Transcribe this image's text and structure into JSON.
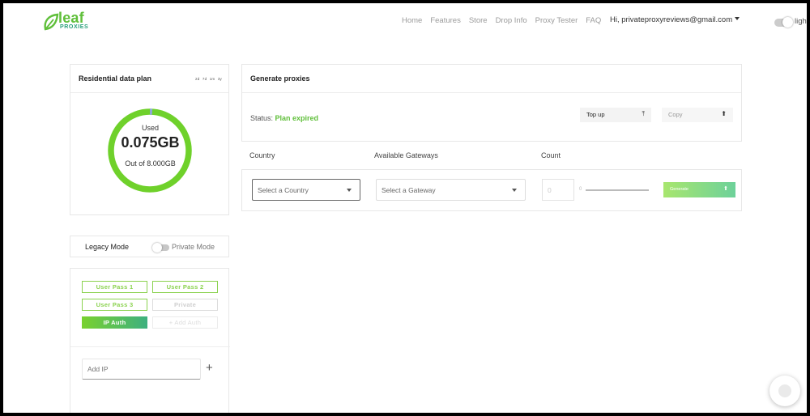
{
  "brand": {
    "name": "leaf",
    "sub": "PROXIES"
  },
  "nav": {
    "items": [
      "Home",
      "Features",
      "Store",
      "Drop Info",
      "Proxy Tester",
      "FAQ"
    ],
    "user": "Hi, privateproxyreviews@gmail.com",
    "theme_label": "light"
  },
  "plan": {
    "title": "Residential data plan",
    "range_tabs": [
      "2d",
      "7d",
      "1m",
      "3y"
    ],
    "used_label": "Used",
    "used_value": "0.075GB",
    "total_label": "Out of 8.000GB",
    "used_fraction": 0.009,
    "ring_color": "#6fd12b",
    "used_color": "#8ea7d8"
  },
  "mode": {
    "legacy": "Legacy Mode",
    "private": "Private Mode"
  },
  "auth": {
    "buttons": [
      "User Pass 1",
      "User Pass 2",
      "User Pass 3",
      "Private",
      "IP Auth",
      "+ Add Auth"
    ],
    "ip_placeholder": "Add IP",
    "add_icon": "+"
  },
  "generate": {
    "title": "Generate proxies",
    "status_label": "Status:",
    "status_value": "Plan expired",
    "topup_label": "Top up",
    "copy_label": "Copy"
  },
  "form": {
    "country_label": "Country",
    "gateway_label": "Available Gateways",
    "count_label": "Count",
    "country_placeholder": "Select a Country",
    "gateway_placeholder": "Select a Gateway",
    "count_value": "0",
    "slider_min": "0",
    "generate_label": "Generate"
  }
}
